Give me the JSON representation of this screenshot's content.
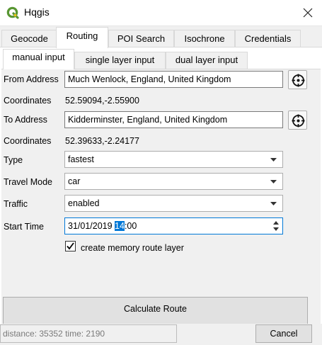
{
  "window": {
    "title": "Hqgis",
    "app_icon": "qgis-logo-icon",
    "close_icon": "close-icon"
  },
  "tabs": [
    "Geocode",
    "Routing",
    "POI Search",
    "Isochrone",
    "Credentials"
  ],
  "active_tab": "Routing",
  "subtabs": [
    "manual input",
    "single layer input",
    "dual layer input"
  ],
  "active_subtab": "manual input",
  "form": {
    "from_label": "From Address",
    "from_value": "Much Wenlock, England, United Kingdom",
    "from_coord_label": "Coordinates",
    "from_coord_value": "52.59094,-2.55900",
    "to_label": "To Address",
    "to_value": "Kidderminster, England, United Kingdom",
    "to_coord_label": "Coordinates",
    "to_coord_value": "52.39633,-2.24177",
    "type_label": "Type",
    "type_value": "fastest",
    "mode_label": "Travel Mode",
    "mode_value": "car",
    "traffic_label": "Traffic",
    "traffic_value": "enabled",
    "start_label": "Start Time",
    "start_prefix": "31/01/2019 ",
    "start_selected": "14",
    "start_suffix": ":00",
    "memory_layer_label": "create memory  route layer",
    "memory_layer_checked": true,
    "locate_icon": "crosshair-icon"
  },
  "buttons": {
    "calculate": "Calculate Route",
    "cancel": "Cancel"
  },
  "status": {
    "text": "distance: 35352 time: 2190"
  },
  "colors": {
    "accent": "#0078d7",
    "qgis_green": "#589632",
    "qgis_yellow": "#ee7913"
  }
}
